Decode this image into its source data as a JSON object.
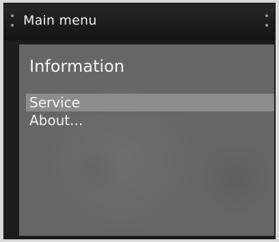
{
  "window": {
    "title": "Main menu"
  },
  "panel": {
    "heading": "Information",
    "menu_items": [
      {
        "label": "Service",
        "selected": true
      },
      {
        "label": "About...",
        "selected": false
      }
    ]
  },
  "colors": {
    "titlebar": "#1c1c1c",
    "panel": "#666666",
    "selection": "#8c8c8c",
    "text": "#f2f2f2"
  }
}
